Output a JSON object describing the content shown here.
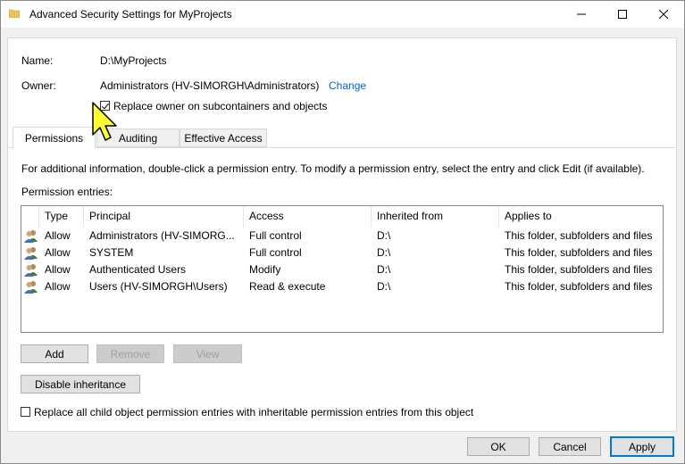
{
  "window": {
    "title": "Advanced Security Settings for MyProjects",
    "minimize_glyph": "—",
    "maximize_glyph": "☐",
    "close_glyph": "✕"
  },
  "name_row": {
    "label": "Name:",
    "value": "D:\\MyProjects"
  },
  "owner_row": {
    "label": "Owner:",
    "value": "Administrators (HV-SIMORGH\\Administrators)",
    "change_link": "Change"
  },
  "replace_owner": {
    "label": "Replace owner on subcontainers and objects",
    "checked": true
  },
  "tabs": [
    {
      "label": "Permissions",
      "active": true
    },
    {
      "label": "Auditing",
      "active": false
    },
    {
      "label": "Effective Access",
      "active": false
    }
  ],
  "info_text": "For additional information, double-click a permission entry. To modify a permission entry, select the entry and click Edit (if available).",
  "entries_label": "Permission entries:",
  "table": {
    "headers": [
      "Type",
      "Principal",
      "Access",
      "Inherited from",
      "Applies to"
    ],
    "rows": [
      {
        "type": "Allow",
        "principal": "Administrators (HV-SIMORG...",
        "access": "Full control",
        "inherited": "D:\\",
        "applies": "This folder, subfolders and files"
      },
      {
        "type": "Allow",
        "principal": "SYSTEM",
        "access": "Full control",
        "inherited": "D:\\",
        "applies": "This folder, subfolders and files"
      },
      {
        "type": "Allow",
        "principal": "Authenticated Users",
        "access": "Modify",
        "inherited": "D:\\",
        "applies": "This folder, subfolders and files"
      },
      {
        "type": "Allow",
        "principal": "Users (HV-SIMORGH\\Users)",
        "access": "Read & execute",
        "inherited": "D:\\",
        "applies": "This folder, subfolders and files"
      }
    ]
  },
  "buttons": {
    "add": "Add",
    "remove": "Remove",
    "view": "View",
    "disable_inheritance": "Disable inheritance",
    "ok": "OK",
    "cancel": "Cancel",
    "apply": "Apply"
  },
  "replace_child": {
    "label": "Replace all child object permission entries with inheritable permission entries from this object",
    "checked": false
  },
  "colors": {
    "accent": "#0078d7",
    "link": "#0066cc",
    "cursor_fill": "#ffff33"
  }
}
